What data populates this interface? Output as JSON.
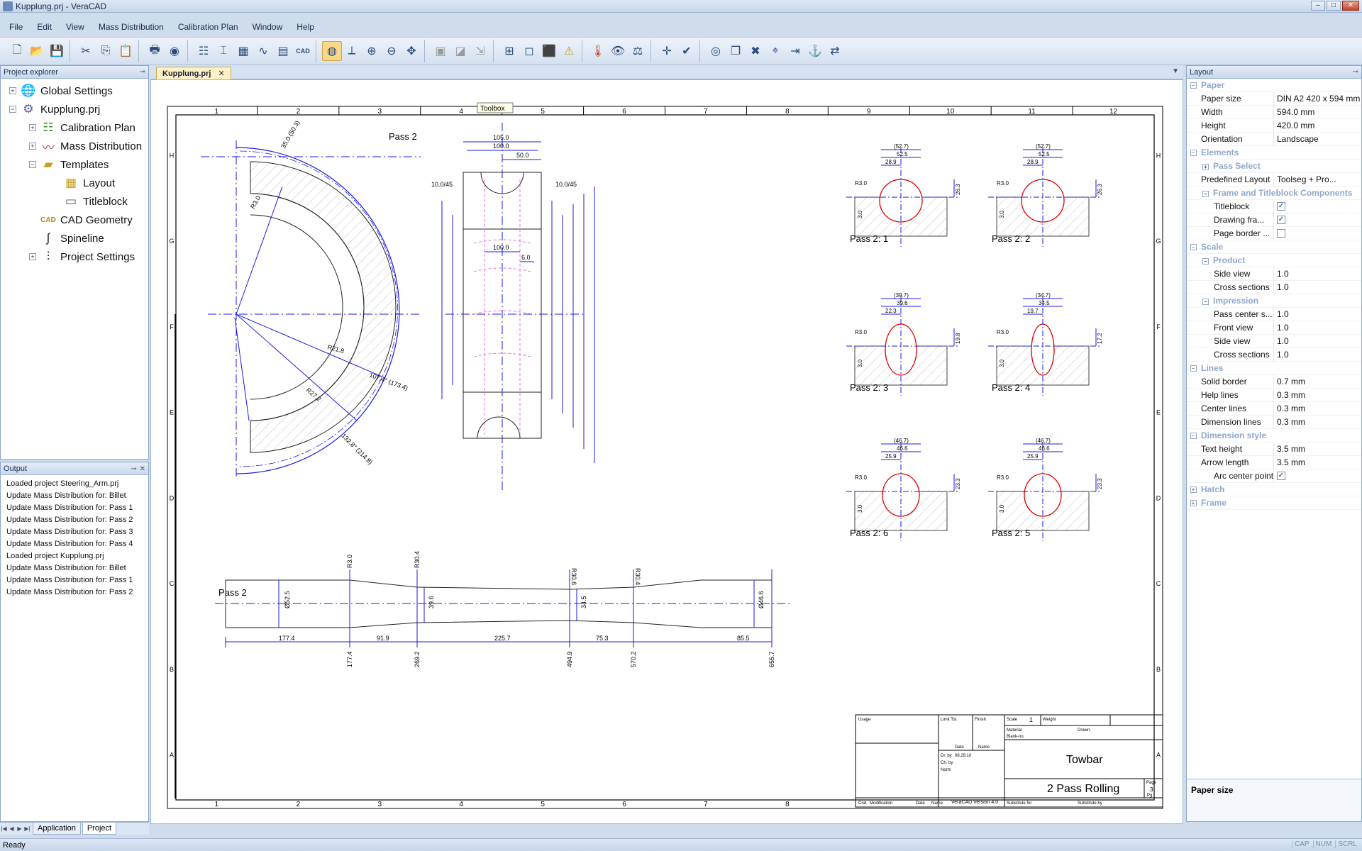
{
  "window": {
    "title": "Kupplung.prj - VeraCAD"
  },
  "menu": [
    {
      "label": "File"
    },
    {
      "label": "Edit"
    },
    {
      "label": "View"
    },
    {
      "label": "Mass Distribution"
    },
    {
      "label": "Calibration Plan"
    },
    {
      "label": "Window"
    },
    {
      "label": "Help"
    }
  ],
  "toolbar": {
    "icons": [
      "new-icon",
      "open-icon",
      "save-icon",
      "cut-icon",
      "copy-icon",
      "paste-icon",
      "print-icon",
      "help-icon",
      "calibration-icon",
      "pass-icon",
      "templates-icon",
      "spline-icon",
      "table-icon",
      "cad-icon",
      "select-icon",
      "axis-icon",
      "zoom-in-icon",
      "zoom-out-icon",
      "fit-icon",
      "frame-icon",
      "frame-select-icon",
      "move-icon",
      "view2d-icon",
      "box-icon",
      "box3d-icon",
      "warning-icon",
      "thermometer-icon",
      "eye-icon",
      "measure-icon",
      "cross-icon",
      "check-icon",
      "visibility-icon",
      "copy-layer-icon",
      "delete-icon",
      "dim-icon",
      "export-icon",
      "anchor-icon",
      "arrows-icon"
    ],
    "labels": {
      "cad": "CAD"
    }
  },
  "project_explorer": {
    "title": "Project explorer",
    "items": [
      {
        "label": "Global Settings",
        "level": 0,
        "expander": "+"
      },
      {
        "label": "Kupplung.prj",
        "level": 0,
        "expander": "−"
      },
      {
        "label": "Calibration Plan",
        "level": 1,
        "expander": "+"
      },
      {
        "label": "Mass Distribution",
        "level": 1,
        "expander": "+"
      },
      {
        "label": "Templates",
        "level": 1,
        "expander": "−"
      },
      {
        "label": "Layout",
        "level": 2,
        "expander": ""
      },
      {
        "label": "Titleblock",
        "level": 2,
        "expander": ""
      },
      {
        "label": "CAD Geometry",
        "level": 1,
        "expander": ""
      },
      {
        "label": "Spineline",
        "level": 1,
        "expander": ""
      },
      {
        "label": "Project Settings",
        "level": 1,
        "expander": "+"
      }
    ]
  },
  "output": {
    "title": "Output",
    "lines": [
      "Loaded project Steering_Arm.prj",
      "Update Mass Distribution for: Billet",
      "Update Mass Distribution for: Pass 1",
      "Update Mass Distribution for: Pass 2",
      "Update Mass Distribution for: Pass 3",
      "Update Mass Distribution for: Pass 4",
      "Loaded project Kupplung.prj",
      "Update Mass Distribution for: Billet",
      "Update Mass Distribution for: Pass 1",
      "Update Mass Distribution for: Pass 2"
    ]
  },
  "bottom_tabs": [
    "Application",
    "Project"
  ],
  "document": {
    "tab": "Kupplung.prj",
    "tooltip": "Toolbox",
    "col_numbers": [
      "1",
      "2",
      "3",
      "4",
      "5",
      "6",
      "7",
      "8",
      "9",
      "10",
      "11",
      "12"
    ],
    "bottom_col_numbers": [
      "1",
      "2",
      "3",
      "4",
      "5",
      "6",
      "7",
      "8"
    ],
    "row_letters": [
      "H",
      "G",
      "F",
      "E",
      "D",
      "C",
      "B",
      "A"
    ],
    "labels": {
      "pass2_top": "Pass 2",
      "pass2_side": "Pass 2",
      "pass_2_1": "Pass 2: 1",
      "pass_2_2": "Pass 2: 2",
      "pass_2_3": "Pass 2: 3",
      "pass_2_4": "Pass 2: 4",
      "pass_2_6": "Pass 2: 6",
      "pass_2_5": "Pass 2: 5"
    },
    "dims": {
      "roll_top_1": "105.0",
      "roll_top_2": "100.0",
      "roll_top_3": "50.0",
      "roll_left": "10.0/45",
      "roll_right": "10.0/45",
      "roll_mid": "100.0",
      "roll_six": "6.0",
      "side_1": "177.4",
      "side_2": "91.9",
      "side_3": "225.7",
      "side_4": "75.3",
      "side_5": "85.5",
      "sb_1": "177.4",
      "sb_2": "269.2",
      "sb_3": "494.9",
      "sb_4": "570.2",
      "sb_5": "655.7",
      "r_3": "R3.0",
      "r_304": "R30.4",
      "r_306": "R30.6",
      "r_304b": "R30.4",
      "d_525": "Ø52.5",
      "d_396": "39.6",
      "d_345": "34.5",
      "d_466": "Ø46.6",
      "arc_r218": "R21.8",
      "arc_r272": "R27.2",
      "arc_ang1": "107.4° (173.4)",
      "arc_ang2": "132.8° (214.8)",
      "arc_r3": "R3.0",
      "arc_d": "35.0 (50.3)"
    },
    "sections": [
      {
        "top": "(52.7)",
        "mid": "52.5",
        "low": "28.9",
        "right": "26.3",
        "r": "R3.0",
        "h": "3.0"
      },
      {
        "top": "(52.7)",
        "mid": "52.5",
        "low": "28.9",
        "right": "26.3",
        "r": "R3.0",
        "h": "3.0"
      },
      {
        "top": "(39.7)",
        "mid": "39.6",
        "low": "22.3",
        "right": "19.8",
        "r": "R3.0",
        "h": "3.0"
      },
      {
        "top": "(34.7)",
        "mid": "34.5",
        "low": "19.7",
        "right": "17.2",
        "r": "R3.0",
        "h": "3.0"
      },
      {
        "top": "(46.7)",
        "mid": "46.6",
        "low": "25.9",
        "right": "23.3",
        "r": "R3.0",
        "h": "3.0"
      },
      {
        "top": "(46.7)",
        "mid": "46.6",
        "low": "25.9",
        "right": "23.3",
        "r": "R3.0",
        "h": "3.0"
      }
    ],
    "titleblock": {
      "usage": "Usage",
      "limit": "Limit Tol.",
      "finish": "Finish",
      "scale_label": "Scale",
      "scale": "1",
      "weight": "Weight",
      "material": "Material",
      "drawn": "Drawn.",
      "blank": "Blank-no.",
      "date": "Date",
      "name": "Name",
      "date_val": "08.29.10",
      "drawn_by": "Dr. by",
      "ch_by": "Ch. by",
      "norm": "Norm",
      "company": "Towbar",
      "drawing_title": "2 Pass Rolling",
      "page_label": "Page",
      "page": "3",
      "pag": "Pg",
      "cond": "Cnd.",
      "modification": "Modification",
      "date2": "Date",
      "name2": "Name",
      "version": "VeraCAD Version 4.0",
      "substitute_for": "Substitute for",
      "substitute_by": "Substitute by"
    }
  },
  "layout_panel": {
    "title": "Layout",
    "rows": [
      {
        "type": "cat",
        "name": "Paper",
        "exp": "−"
      },
      {
        "type": "prop",
        "name": "Paper size",
        "value": "DIN A2 420 x 594 mm",
        "dropdown": true
      },
      {
        "type": "prop",
        "name": "Width",
        "value": "594.0 mm"
      },
      {
        "type": "prop",
        "name": "Height",
        "value": "420.0 mm"
      },
      {
        "type": "prop",
        "name": "Orientation",
        "value": "Landscape"
      },
      {
        "type": "cat",
        "name": "Elements",
        "exp": "−"
      },
      {
        "type": "subcat",
        "name": "Pass Select",
        "exp": "+"
      },
      {
        "type": "prop",
        "name": "Predefined Layout",
        "value": "Toolseg + Pro..."
      },
      {
        "type": "subcat",
        "name": "Frame and Titleblock Components",
        "exp": "−"
      },
      {
        "type": "check",
        "name": "Titleblock",
        "checked": true
      },
      {
        "type": "check",
        "name": "Drawing fra...",
        "checked": true
      },
      {
        "type": "check",
        "name": "Page border ...",
        "checked": false
      },
      {
        "type": "cat",
        "name": "Scale",
        "exp": "−"
      },
      {
        "type": "subcat",
        "name": "Product",
        "exp": "−"
      },
      {
        "type": "prop2",
        "name": "Side view",
        "value": "1.0"
      },
      {
        "type": "prop2",
        "name": "Cross sections",
        "value": "1.0"
      },
      {
        "type": "subcat",
        "name": "Impression",
        "exp": "−"
      },
      {
        "type": "prop2",
        "name": "Pass center s...",
        "value": "1.0"
      },
      {
        "type": "prop2",
        "name": "Front view",
        "value": "1.0"
      },
      {
        "type": "prop2",
        "name": "Side view",
        "value": "1.0"
      },
      {
        "type": "prop2",
        "name": "Cross sections",
        "value": "1.0"
      },
      {
        "type": "cat",
        "name": "Lines",
        "exp": "−"
      },
      {
        "type": "prop",
        "name": "Solid border",
        "value": "0.7 mm"
      },
      {
        "type": "prop",
        "name": "Help lines",
        "value": "0.3 mm"
      },
      {
        "type": "prop",
        "name": "Center lines",
        "value": "0.3 mm"
      },
      {
        "type": "prop",
        "name": "Dimension lines",
        "value": "0.3 mm"
      },
      {
        "type": "cat",
        "name": "Dimension style",
        "exp": "−"
      },
      {
        "type": "prop",
        "name": "Text height",
        "value": "3.5 mm"
      },
      {
        "type": "prop",
        "name": "Arrow length",
        "value": "3.5 mm"
      },
      {
        "type": "check",
        "name": "Arc center point",
        "checked": true
      },
      {
        "type": "cat",
        "name": "Hatch",
        "exp": "+"
      },
      {
        "type": "cat",
        "name": "Frame",
        "exp": "+"
      }
    ],
    "description_title": "Paper size"
  },
  "status": {
    "text": "Ready",
    "indicators": [
      "CAP",
      "NUM",
      "SCRL"
    ]
  },
  "colors": {
    "dimension": "#1a1ae6",
    "profile": "#e00000",
    "pink_lines": "#e070e0",
    "frame": "#000000"
  }
}
